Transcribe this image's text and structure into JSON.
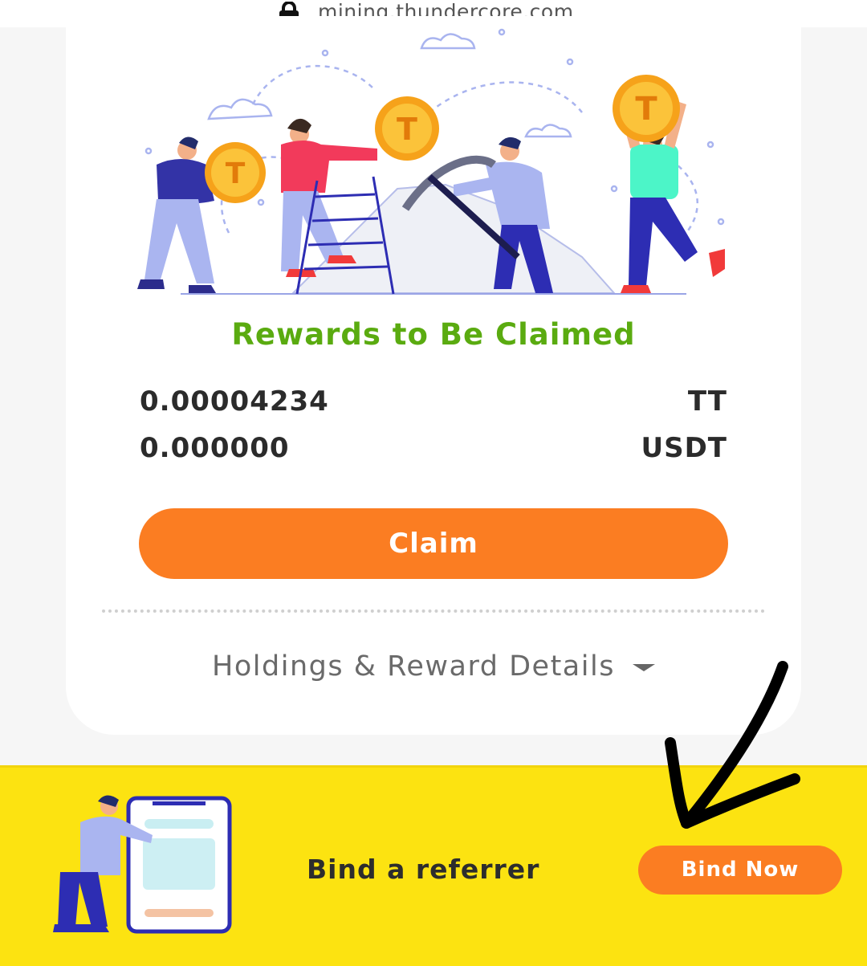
{
  "browser": {
    "url": "mining.thundercore.com",
    "lock_icon": "lock-icon"
  },
  "rewards": {
    "title": "Rewards to Be Claimed",
    "title_color": "#5aab10",
    "items": [
      {
        "amount": "0.00004234",
        "unit": "TT"
      },
      {
        "amount": "0.000000",
        "unit": "USDT"
      }
    ],
    "claim_label": "Claim",
    "accent_color": "#fb7d22"
  },
  "details": {
    "label": "Holdings & Reward Details",
    "icon": "caret-down-icon"
  },
  "referrer": {
    "text": "Bind a referrer",
    "button_label": "Bind Now",
    "background": "#fce311"
  },
  "annotation": {
    "icon": "hand-drawn-arrow-icon"
  }
}
